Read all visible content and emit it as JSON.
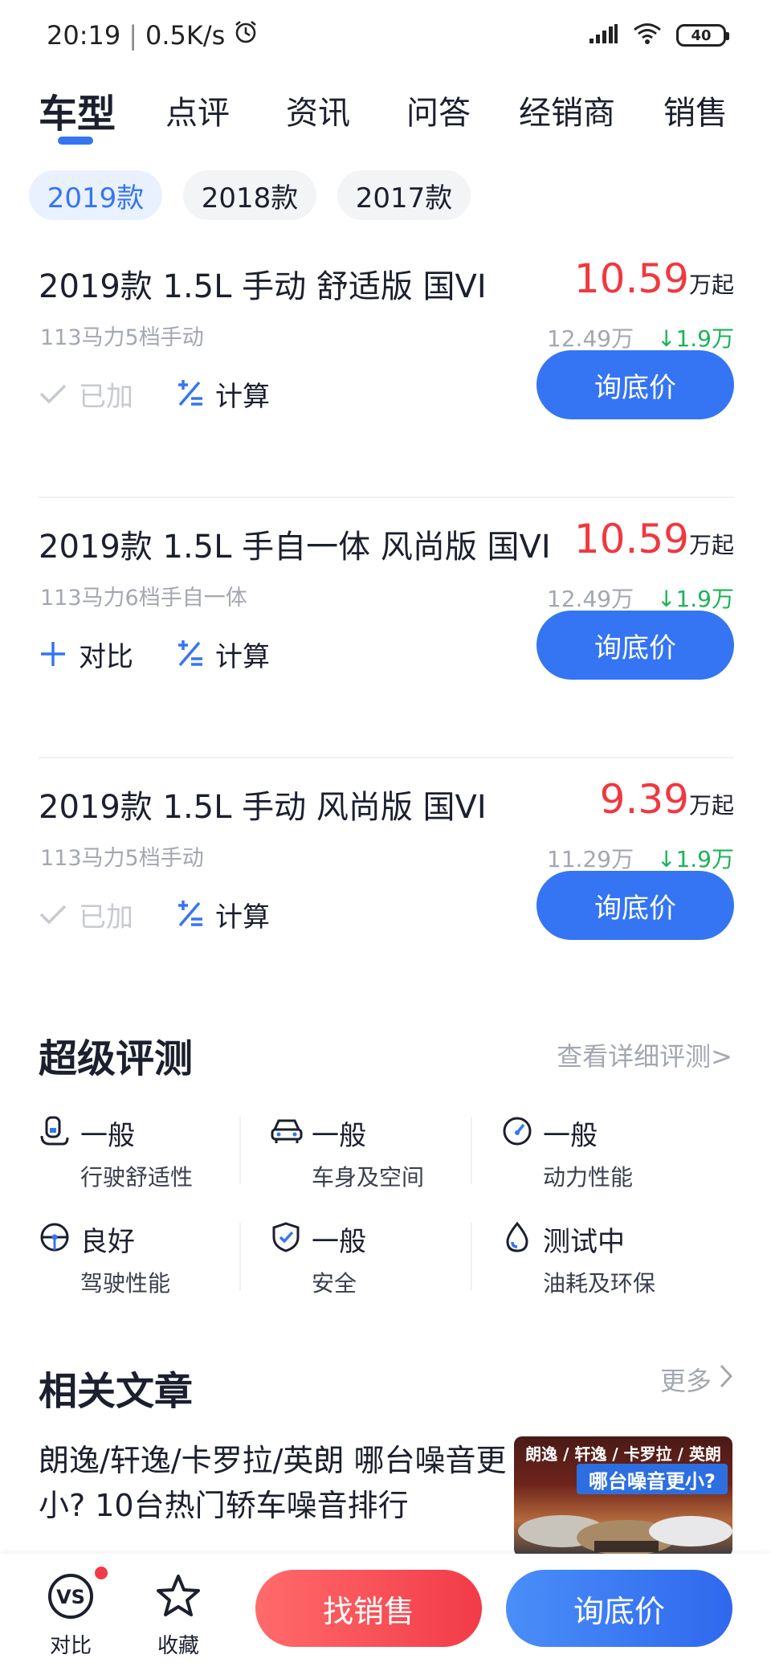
{
  "status_bar": {
    "time": "20:19",
    "speed": "0.5K/s",
    "battery": "40"
  },
  "tabs": [
    {
      "label": "车型",
      "active": true
    },
    {
      "label": "点评"
    },
    {
      "label": "资讯"
    },
    {
      "label": "问答"
    },
    {
      "label": "经销商"
    },
    {
      "label": "销售"
    }
  ],
  "years": [
    {
      "label": "2019款",
      "active": true
    },
    {
      "label": "2018款"
    },
    {
      "label": "2017款"
    }
  ],
  "models": [
    {
      "name": "2019款 1.5L 手动 舒适版 国VI",
      "spec": "113马力5档手动",
      "price": "10.59",
      "price_unit": "万起",
      "msrp": "12.49万",
      "drop": "1.9万",
      "compare_label": "已加",
      "compare_state": "added",
      "calc_label": "计算",
      "ask_label": "询底价"
    },
    {
      "name": "2019款 1.5L 手自一体 风尚版 国VI",
      "spec": "113马力6档手自一体",
      "price": "10.59",
      "price_unit": "万起",
      "msrp": "12.49万",
      "drop": "1.9万",
      "compare_label": "对比",
      "compare_state": "compare",
      "calc_label": "计算",
      "ask_label": "询底价"
    },
    {
      "name": "2019款 1.5L 手动 风尚版 国VI",
      "spec": "113马力5档手动",
      "price": "9.39",
      "price_unit": "万起",
      "msrp": "11.29万",
      "drop": "1.9万",
      "compare_label": "已加",
      "compare_state": "added",
      "calc_label": "计算",
      "ask_label": "询底价"
    }
  ],
  "review": {
    "title": "超级评测",
    "link": "查看详细评测>",
    "metrics": [
      {
        "rating": "一般",
        "label": "行驶舒适性",
        "icon": "seat-icon"
      },
      {
        "rating": "一般",
        "label": "车身及空间",
        "icon": "car-icon"
      },
      {
        "rating": "一般",
        "label": "动力性能",
        "icon": "speedometer-icon"
      },
      {
        "rating": "良好",
        "label": "驾驶性能",
        "icon": "steering-wheel-icon"
      },
      {
        "rating": "一般",
        "label": "安全",
        "icon": "shield-icon"
      },
      {
        "rating": "测试中",
        "label": "油耗及环保",
        "icon": "fuel-drop-icon"
      }
    ]
  },
  "articles": {
    "title": "相关文章",
    "more": "更多",
    "items": [
      {
        "title": "朗逸/轩逸/卡罗拉/英朗 哪台噪音更小? 10台热门轿车噪音排行",
        "thumb_top": "朗逸 / 轩逸 / 卡罗拉 / 英朗",
        "thumb_banner": "哪台噪音更小?"
      }
    ]
  },
  "bottom_bar": {
    "compare_label": "对比",
    "favorite_label": "收藏",
    "find_sales_label": "找销售",
    "ask_price_label": "询底价"
  },
  "colors": {
    "accent": "#3575f3",
    "price": "#f0383f",
    "drop": "#1bb359",
    "muted": "#a3a7b0"
  }
}
